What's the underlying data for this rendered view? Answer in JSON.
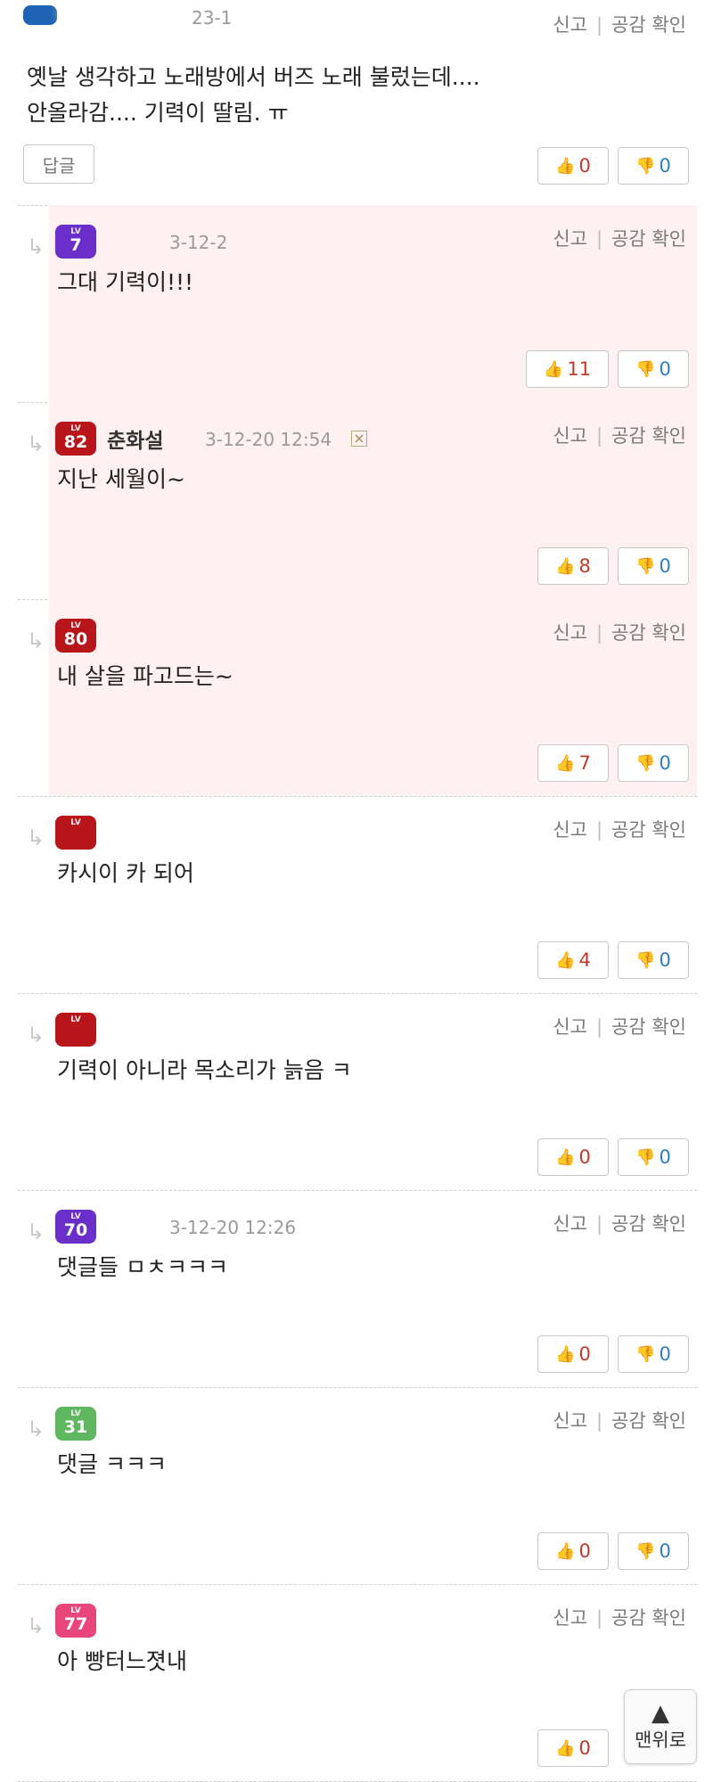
{
  "common": {
    "report_label": "신고",
    "separator": "|",
    "agree_check_label": "공감 확인",
    "reply_button_label": "답글",
    "reply_arrow": "↳",
    "thumb_up_icon": "thumbs-up-icon",
    "thumb_down_icon": "thumbs-down-icon"
  },
  "top_comment": {
    "time": "23-1",
    "text_line1": "옛날 생각하고 노래방에서 버즈 노래 불렀는데....",
    "text_line2": "안올라감.... 기력이 딸림. ㅠ",
    "likes": "0",
    "dislikes": "0"
  },
  "replies": [
    {
      "level": "7",
      "level_color": "#6b2fc9",
      "nick": "",
      "time": "3-12-2",
      "text": "그대 기력이!!!",
      "likes": "11",
      "dislikes": "0",
      "highlight": true
    },
    {
      "level": "82",
      "level_color": "#b8161b",
      "nick": "춘화설",
      "time": "3-12-20 12:54",
      "text": "지난 세월이~",
      "likes": "8",
      "dislikes": "0",
      "highlight": true
    },
    {
      "level": "80",
      "level_color": "#b8161b",
      "nick": "",
      "time": "",
      "text": "내 살을 파고드는~",
      "likes": "7",
      "dislikes": "0",
      "highlight": true
    },
    {
      "level": "",
      "level_color": "#b8161b",
      "nick": "",
      "time": "",
      "text": "카시이 카 되어",
      "likes": "4",
      "dislikes": "0",
      "highlight": false
    },
    {
      "level": "",
      "level_color": "#b8161b",
      "nick": "",
      "time": "",
      "text": "기력이 아니라 목소리가 늙음 ㅋ",
      "likes": "0",
      "dislikes": "0",
      "highlight": false
    },
    {
      "level": "70",
      "level_color": "#6b2fc9",
      "nick": "",
      "time": "3-12-20 12:26",
      "text": "댓글들 ㅁㅊㅋㅋㅋ",
      "likes": "0",
      "dislikes": "0",
      "highlight": false
    },
    {
      "level": "31",
      "level_color": "#5fb85f",
      "nick": "",
      "time": "",
      "text": "댓글 ㅋㅋㅋ",
      "likes": "0",
      "dislikes": "0",
      "highlight": false
    },
    {
      "level": "77",
      "level_color": "#e8457a",
      "nick": "",
      "time": "",
      "text": "아 빵터느졋내",
      "likes": "0",
      "dislikes": "",
      "highlight": false
    }
  ],
  "scroll_top": {
    "arrow": "▲",
    "label": "맨위로"
  }
}
